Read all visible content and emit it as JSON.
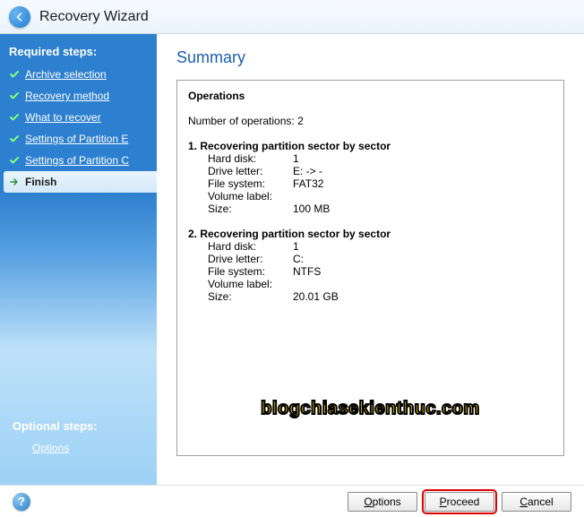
{
  "titlebar": {
    "title": "Recovery Wizard"
  },
  "sidebar": {
    "required_header": "Required steps:",
    "steps": [
      {
        "label": "Archive selection",
        "done": true
      },
      {
        "label": "Recovery method",
        "done": true
      },
      {
        "label": "What to recover",
        "done": true
      },
      {
        "label": "Settings of Partition E",
        "done": true
      },
      {
        "label": "Settings of Partition C",
        "done": true
      },
      {
        "label": "Finish",
        "active": true
      }
    ],
    "optional_header": "Optional steps:",
    "options_label": "Options"
  },
  "main": {
    "title": "Summary",
    "operations_header": "Operations",
    "count_label": "Number of operations: 2",
    "ops": [
      {
        "head": "1. Recovering partition sector by sector",
        "rows": [
          {
            "k": "Hard disk:",
            "v": "1"
          },
          {
            "k": "Drive letter:",
            "v": "E: -> -"
          },
          {
            "k": "File system:",
            "v": "FAT32"
          },
          {
            "k": "Volume label:",
            "v": ""
          },
          {
            "k": "Size:",
            "v": "100 MB"
          }
        ]
      },
      {
        "head": "2. Recovering partition sector by sector",
        "rows": [
          {
            "k": "Hard disk:",
            "v": "1"
          },
          {
            "k": "Drive letter:",
            "v": "C:"
          },
          {
            "k": "File system:",
            "v": "NTFS"
          },
          {
            "k": "Volume label:",
            "v": ""
          },
          {
            "k": "Size:",
            "v": "20.01 GB"
          }
        ]
      }
    ]
  },
  "watermark": "blogchiasekienthuc.com",
  "footer": {
    "options": "Options",
    "proceed": "Proceed",
    "cancel": "Cancel"
  }
}
